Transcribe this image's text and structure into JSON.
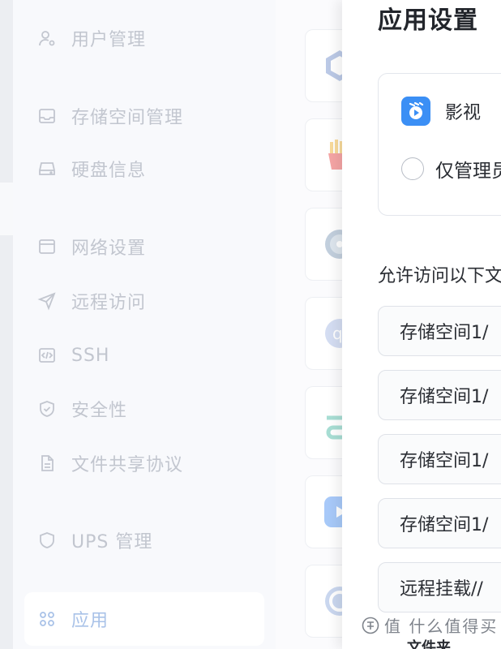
{
  "sidebar": {
    "items": [
      {
        "label": "用户管理",
        "icon": "user-gear-icon"
      },
      {
        "label": "存储空间管理",
        "icon": "inbox-tray-icon"
      },
      {
        "label": "硬盘信息",
        "icon": "hard-drive-icon"
      },
      {
        "label": "网络设置",
        "icon": "network-window-icon"
      },
      {
        "label": "远程访问",
        "icon": "send-arrow-icon"
      },
      {
        "label": "SSH",
        "icon": "code-terminal-icon"
      },
      {
        "label": "安全性",
        "icon": "shield-check-icon"
      },
      {
        "label": "文件共享协议",
        "icon": "document-icon"
      },
      {
        "label": "UPS 管理",
        "icon": "shield-icon"
      },
      {
        "label": "应用",
        "icon": "grid-apps-icon",
        "active": true
      }
    ]
  },
  "panel": {
    "title": "应用设置",
    "app_name": "影视",
    "radio_label": "仅管理员",
    "access_label": "允许访问以下文件夹",
    "paths": [
      "存储空间1/",
      "存储空间1/",
      "存储空间1/",
      "存储空间1/",
      "远程挂载//"
    ],
    "bottom_text": "文件夹"
  },
  "watermark": "值 什么值得买",
  "colors": {
    "accent": "#3b8ff5",
    "sidebar_text": "#c2c6cf",
    "active_text": "#a9c2e8"
  }
}
